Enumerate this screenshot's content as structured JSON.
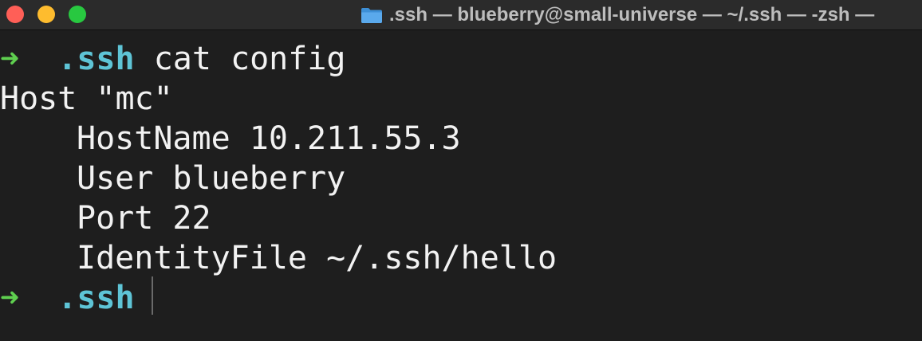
{
  "window": {
    "title": ".ssh — blueberry@small-universe — ~/.ssh — -zsh —",
    "title_icon": "folder-icon",
    "traffic_lights": {
      "close_color": "#ff5f57",
      "minimize_color": "#febc2e",
      "maximize_color": "#28c840"
    }
  },
  "terminal": {
    "prompt_symbol": "➜",
    "prompt_dir": ".ssh",
    "command": "cat config",
    "output": [
      "Host \"mc\"",
      "HostName 10.211.55.3",
      "User blueberry",
      "Port 22",
      "IdentityFile ~/.ssh/hello"
    ],
    "current_prompt_dir": ".ssh",
    "colors": {
      "background": "#1e1e1e",
      "text": "#f2f2f2",
      "prompt_arrow": "#5fcf4f",
      "prompt_dir": "#5ec4d6"
    }
  }
}
